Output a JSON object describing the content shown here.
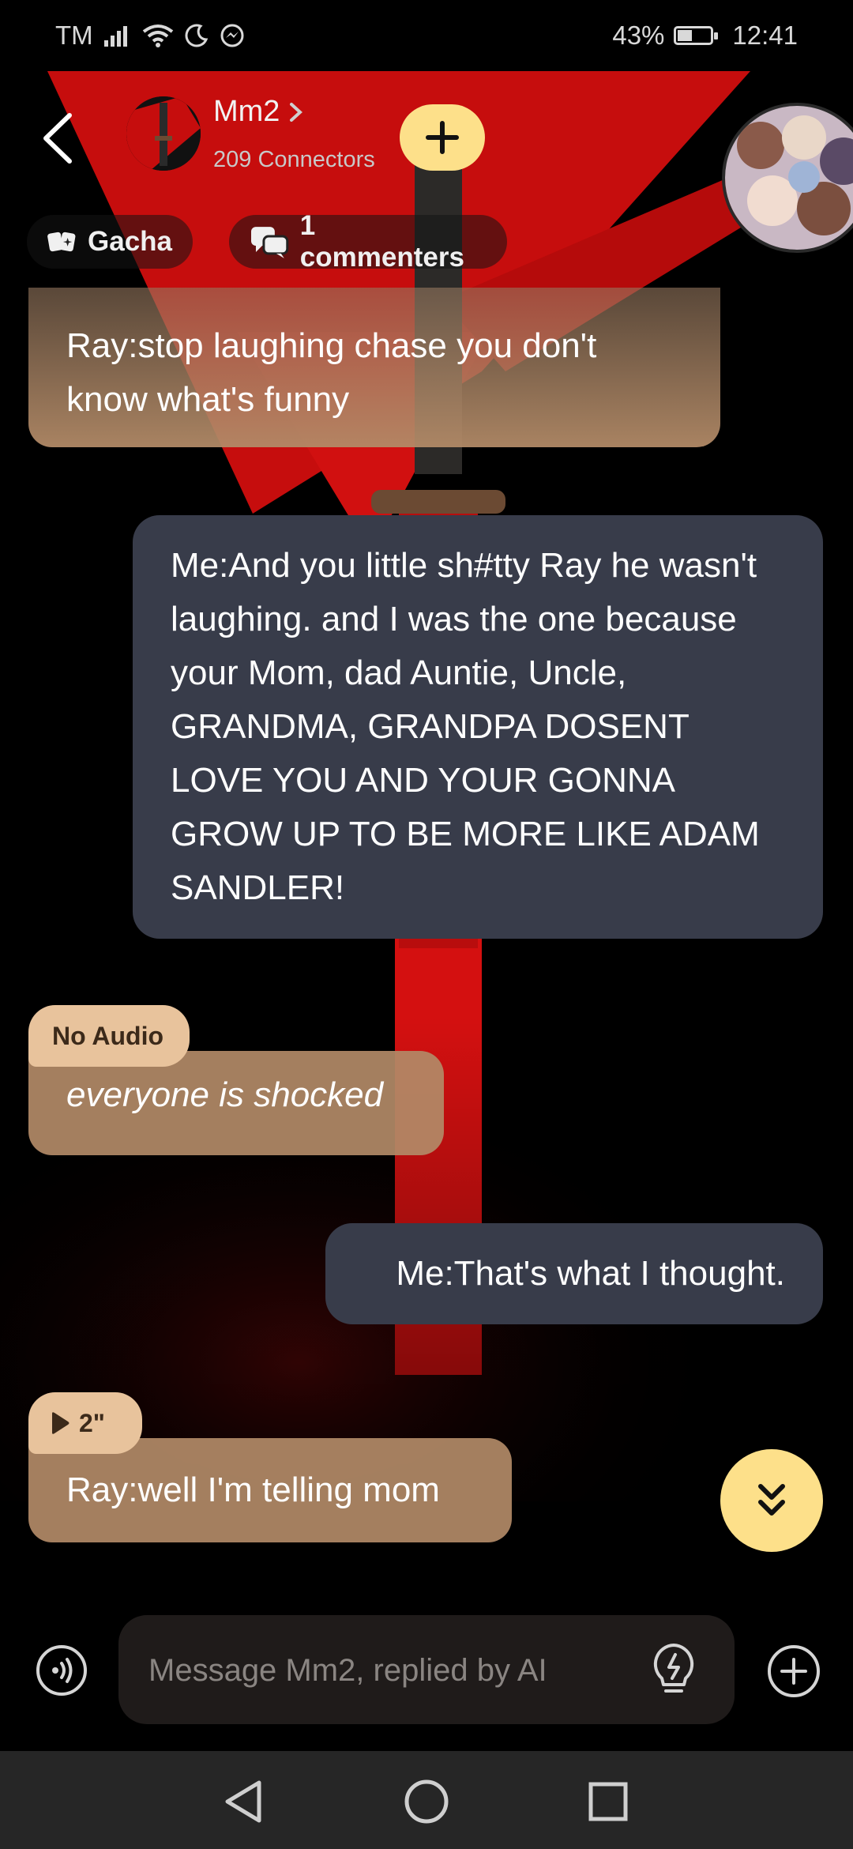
{
  "status_bar": {
    "carrier": "TM",
    "battery": "43%",
    "battery_level": 0.43,
    "time": "12:41"
  },
  "header": {
    "title": "Mm2",
    "subtitle": "209 Connectors",
    "gacha_label": "Gacha",
    "commenters_label": "1 commenters"
  },
  "messages": [
    {
      "role": "character",
      "text": "Ray:stop laughing chase you don't know what's funny"
    },
    {
      "role": "user",
      "text": "Me:And you little sh#tty Ray he wasn't laughing. and I was the one because your Mom, dad Auntie, Uncle, GRANDMA, GRANDPA DOSENT LOVE YOU AND YOUR GONNA GROW UP TO BE MORE LIKE ADAM SANDLER!"
    },
    {
      "role": "character",
      "tag": "No Audio",
      "text": "everyone is shocked"
    },
    {
      "role": "user",
      "text": "Me:That's what I thought."
    },
    {
      "role": "character",
      "tag": "2\"",
      "text": "Ray:well I'm telling mom"
    }
  ],
  "composer": {
    "placeholder": "Message Mm2, replied by AI"
  },
  "colors": {
    "accent_yellow": "#fde08a",
    "character_bubble": "#b28a67",
    "user_bubble": "#383c4a",
    "background_red": "#d41010"
  },
  "icons": {
    "back": "chevron-left-icon",
    "follow": "plus-icon",
    "gacha": "cards-icon",
    "commenters": "chat-bubbles-icon",
    "scroll_down": "double-chevron-down-icon",
    "voice": "voice-call-icon",
    "idea": "lightbulb-icon",
    "attach": "plus-circle-icon"
  }
}
